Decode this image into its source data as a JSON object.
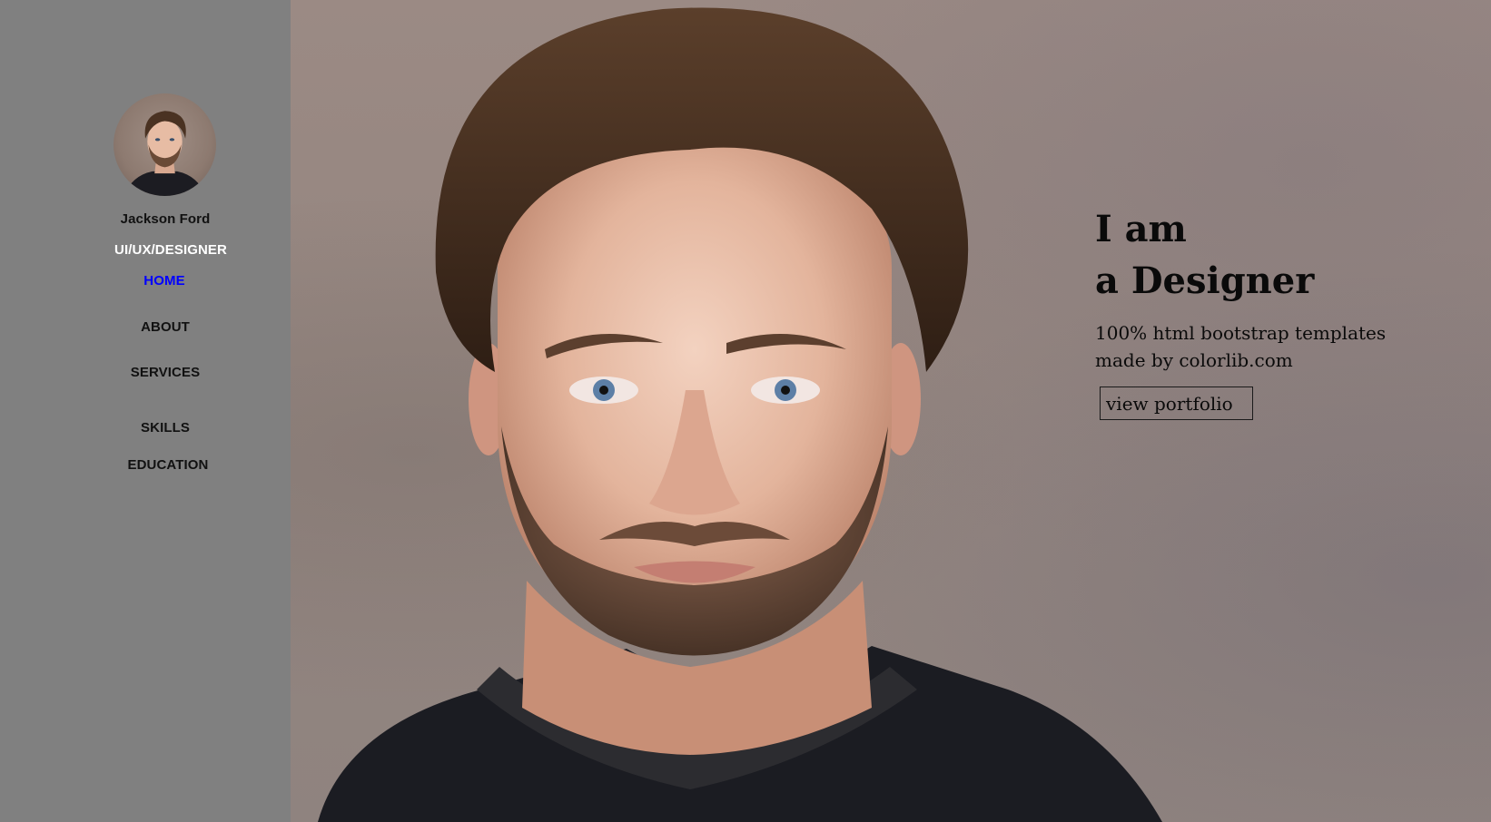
{
  "sidebar": {
    "name": "Jackson Ford",
    "role": "UI/UX/DESIGNER",
    "nav": [
      {
        "label": "HOME",
        "active": true
      },
      {
        "label": "ABOUT",
        "active": false
      },
      {
        "label": "SERVICES",
        "active": false
      },
      {
        "label": "SKILLS",
        "active": false
      },
      {
        "label": "EDUCATION",
        "active": false
      }
    ]
  },
  "hero": {
    "line1": "I am",
    "line2": "a Designer",
    "subtitle": "100% html bootstrap templates made by colorlib.com",
    "button_label": "view portfolio"
  },
  "colors": {
    "sidebar_bg": "#808080",
    "nav_active": "#0000ff",
    "role_text": "#ffffff",
    "text_dark": "#111111"
  }
}
